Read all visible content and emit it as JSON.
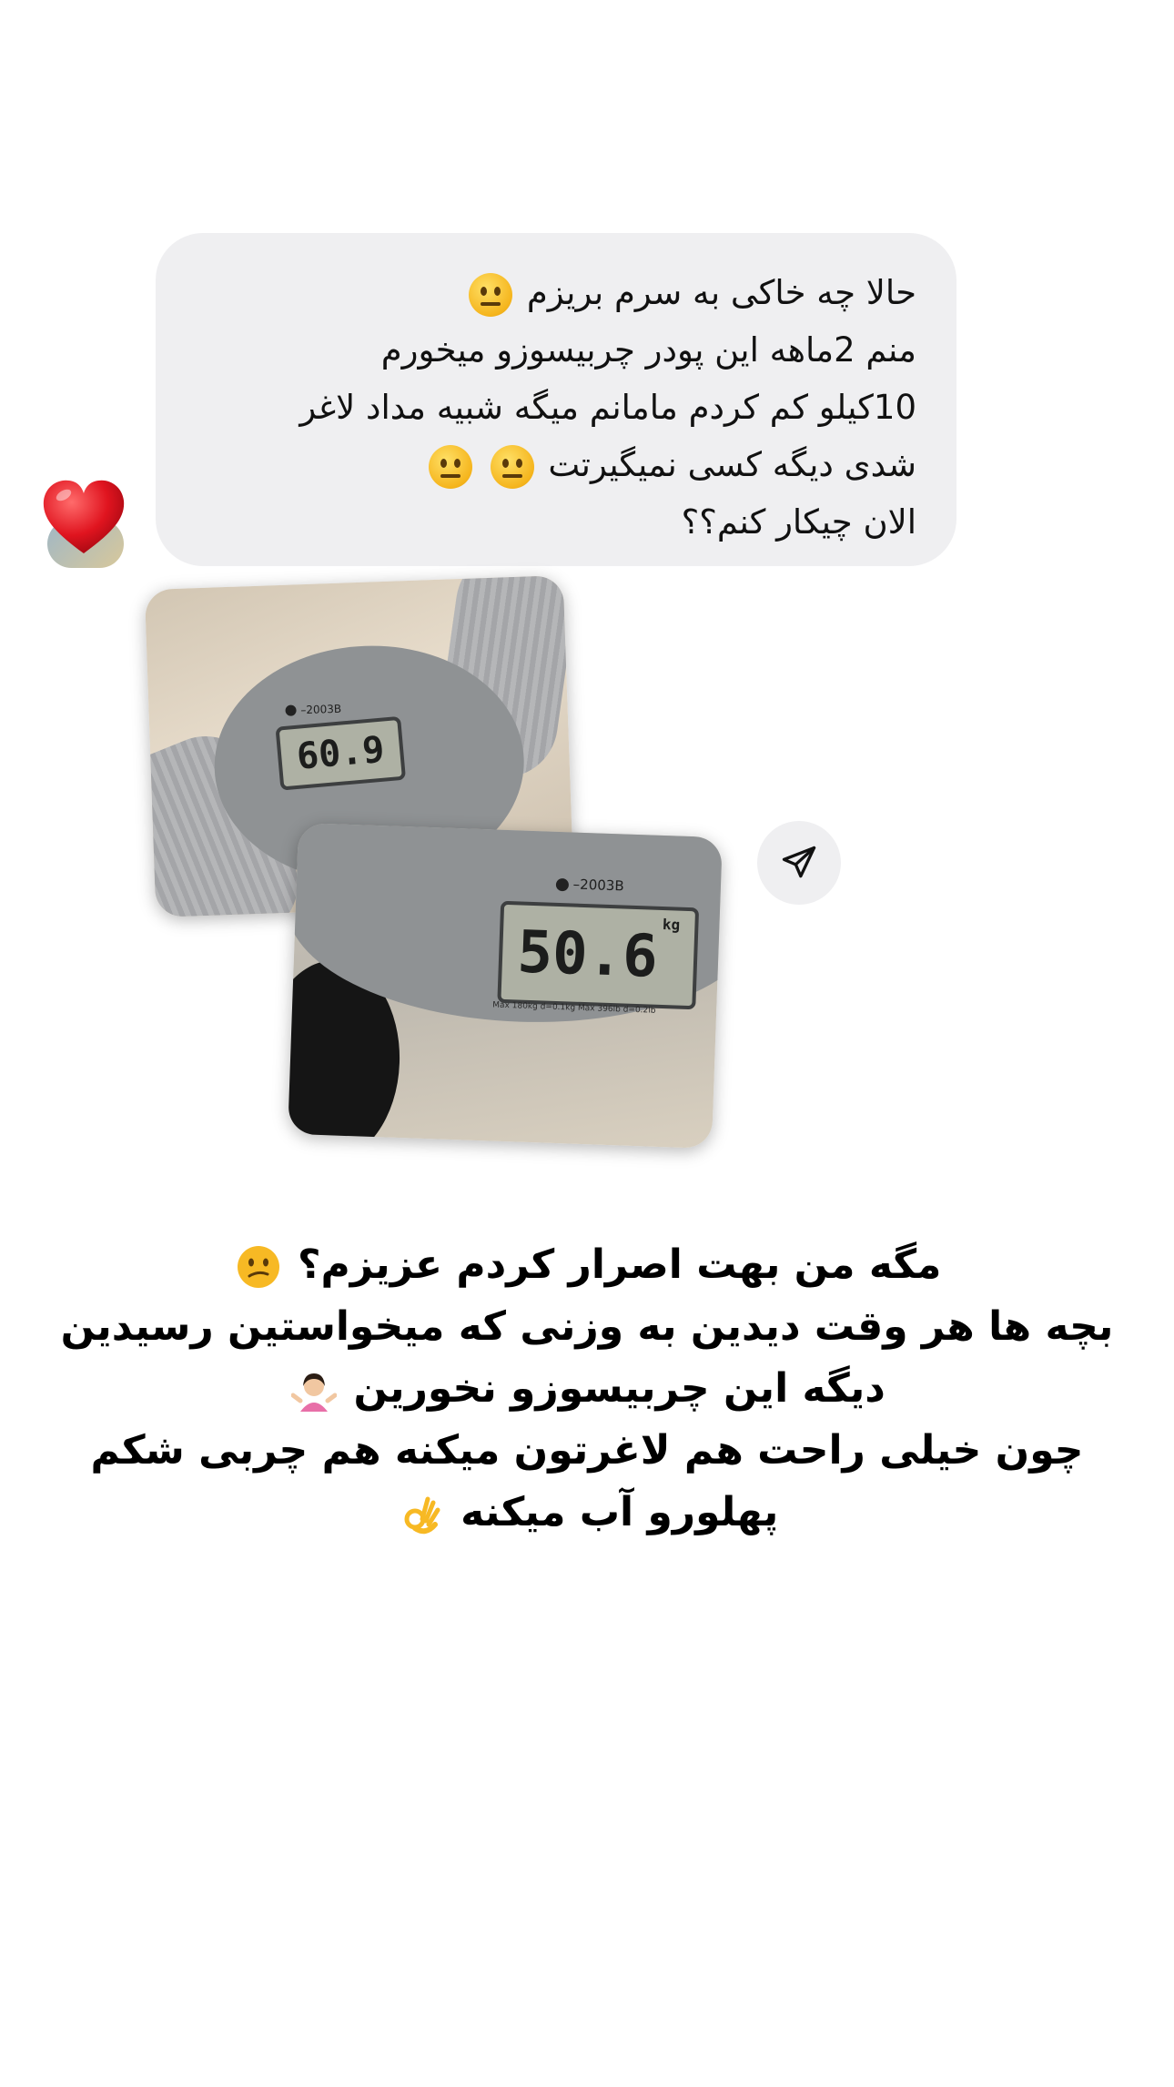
{
  "message": {
    "lines": [
      "حالا چه خاکی به سرم بریزم",
      "منم 2ماهه این پودر چربیسوزو میخورم",
      "10کیلو کم کردم مامانم میگه شبیه مداد لاغر",
      "شدی دیگه کسی  نمیگیرتت",
      "الان چیکار کنم؟؟"
    ],
    "reaction": "heart-emoji"
  },
  "photos": {
    "before": {
      "weight": "60.9",
      "model": "2003B"
    },
    "after": {
      "weight": "50.6",
      "unit": "kg",
      "model": "2003B",
      "fineprint": "Max 180kg d=0.1kg Max 396lb d=0.2lb"
    }
  },
  "share_icon": "paper-plane-icon",
  "caption": {
    "lines": [
      "مگه من بهت اصرار کردم عزیزم؟",
      "بچه ها هر وقت دیدین به وزنی که میخواستین رسیدین",
      "دیگه این چربیسوزو نخورین",
      "چون خیلی راحت هم لاغرتون میکنه هم چربی شکم",
      "پهلورو آب میکنه"
    ]
  },
  "colors": {
    "background": "#ffffff",
    "bubble": "#efeff1",
    "text": "#111111"
  }
}
